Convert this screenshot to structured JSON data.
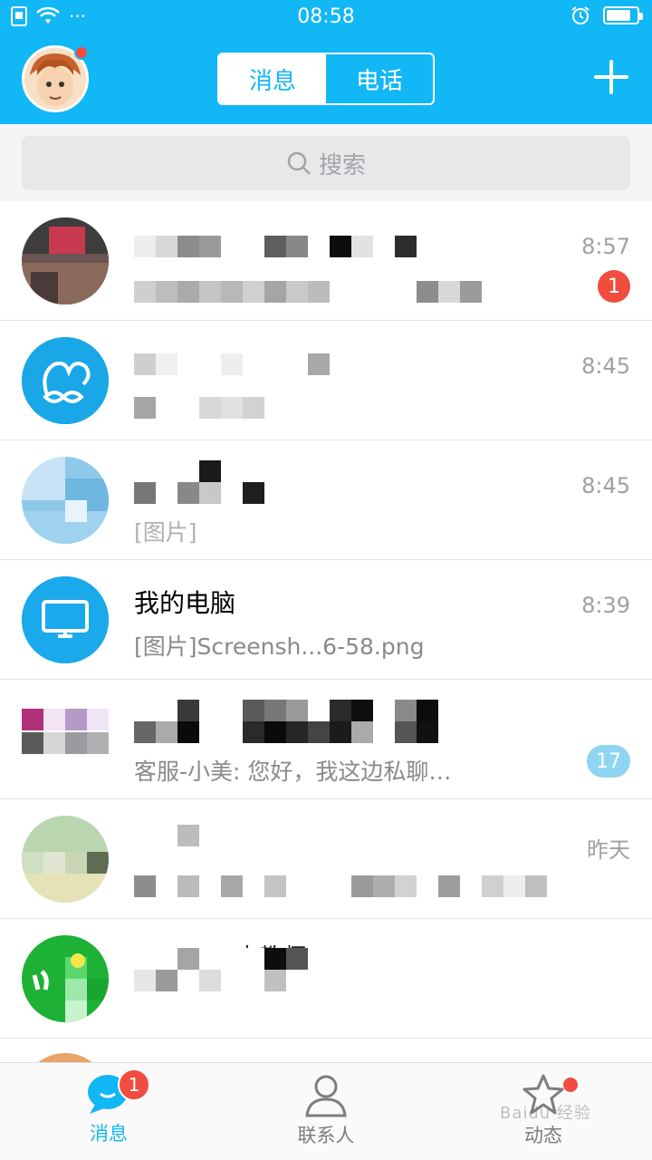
{
  "status_bar": {
    "time": "08:58",
    "dots": "···"
  },
  "header": {
    "tabs": [
      {
        "label": "消息",
        "active": true
      },
      {
        "label": "电话",
        "active": false
      }
    ]
  },
  "search": {
    "placeholder": "搜索"
  },
  "conversations": [
    {
      "time": "8:57",
      "unread": "1"
    },
    {
      "time": "8:45"
    },
    {
      "time": "8:45",
      "preview": "[图片]"
    },
    {
      "name": "我的电脑",
      "time": "8:39",
      "preview": "[图片]Screensh...6-58.png"
    },
    {
      "preview": "客服-小美: 您好，我这边私聊…",
      "unread": "17"
    },
    {
      "time": "昨天"
    },
    {
      "name": "中教师"
    }
  ],
  "tabbar": {
    "items": [
      {
        "label": "消息",
        "badge": "1",
        "active": true
      },
      {
        "label": "联系人"
      },
      {
        "label": "动态"
      }
    ]
  },
  "watermark": "Baidu 经验",
  "colors": {
    "brand": "#12b7f5",
    "badge": "#f04c3f"
  }
}
